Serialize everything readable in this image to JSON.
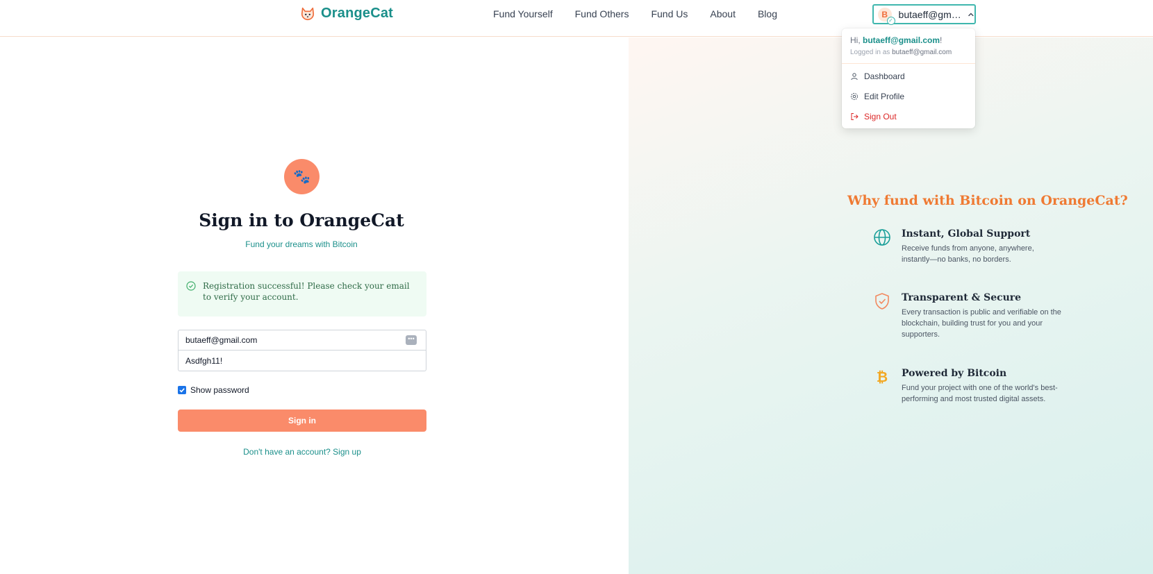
{
  "header": {
    "brand": "OrangeCat",
    "nav": [
      "Fund Yourself",
      "Fund Others",
      "Fund Us",
      "About",
      "Blog"
    ],
    "user": {
      "avatar_initial": "B",
      "display_name": "butaeff@gma..."
    }
  },
  "dropdown": {
    "greeting_prefix": "Hi, ",
    "greeting_email": "butaeff@gmail.com",
    "greeting_suffix": "!",
    "logged_in_prefix": "Logged in as ",
    "logged_in_email": "butaeff@gmail.com",
    "items": {
      "dashboard": "Dashboard",
      "edit_profile": "Edit Profile",
      "sign_out": "Sign Out"
    }
  },
  "signin": {
    "title": "Sign in to OrangeCat",
    "subtitle": "Fund your dreams with Bitcoin",
    "alert": "Registration successful! Please check your email to verify your account.",
    "email_value": "butaeff@gmail.com",
    "password_value": "Asdfgh11!",
    "show_password_label": "Show password",
    "show_password_checked": true,
    "button": "Sign in",
    "signup_link": "Don't have an account? Sign up"
  },
  "why": {
    "title": "Why fund with Bitcoin on OrangeCat?",
    "features": [
      {
        "icon": "globe-icon",
        "title": "Instant, Global Support",
        "desc": "Receive funds from anyone, anywhere, instantly—no banks, no borders."
      },
      {
        "icon": "shield-check-icon",
        "title": "Transparent & Secure",
        "desc": "Every transaction is public and verifiable on the blockchain, building trust for you and your supporters."
      },
      {
        "icon": "bitcoin-icon",
        "title": "Powered by Bitcoin",
        "desc": "Fund your project with one of the world's best-performing and most trusted digital assets."
      }
    ]
  },
  "colors": {
    "brand_teal": "#1a8f8a",
    "brand_orange": "#fa8b6a",
    "title_orange": "#ef7a33",
    "danger": "#dc2626"
  }
}
